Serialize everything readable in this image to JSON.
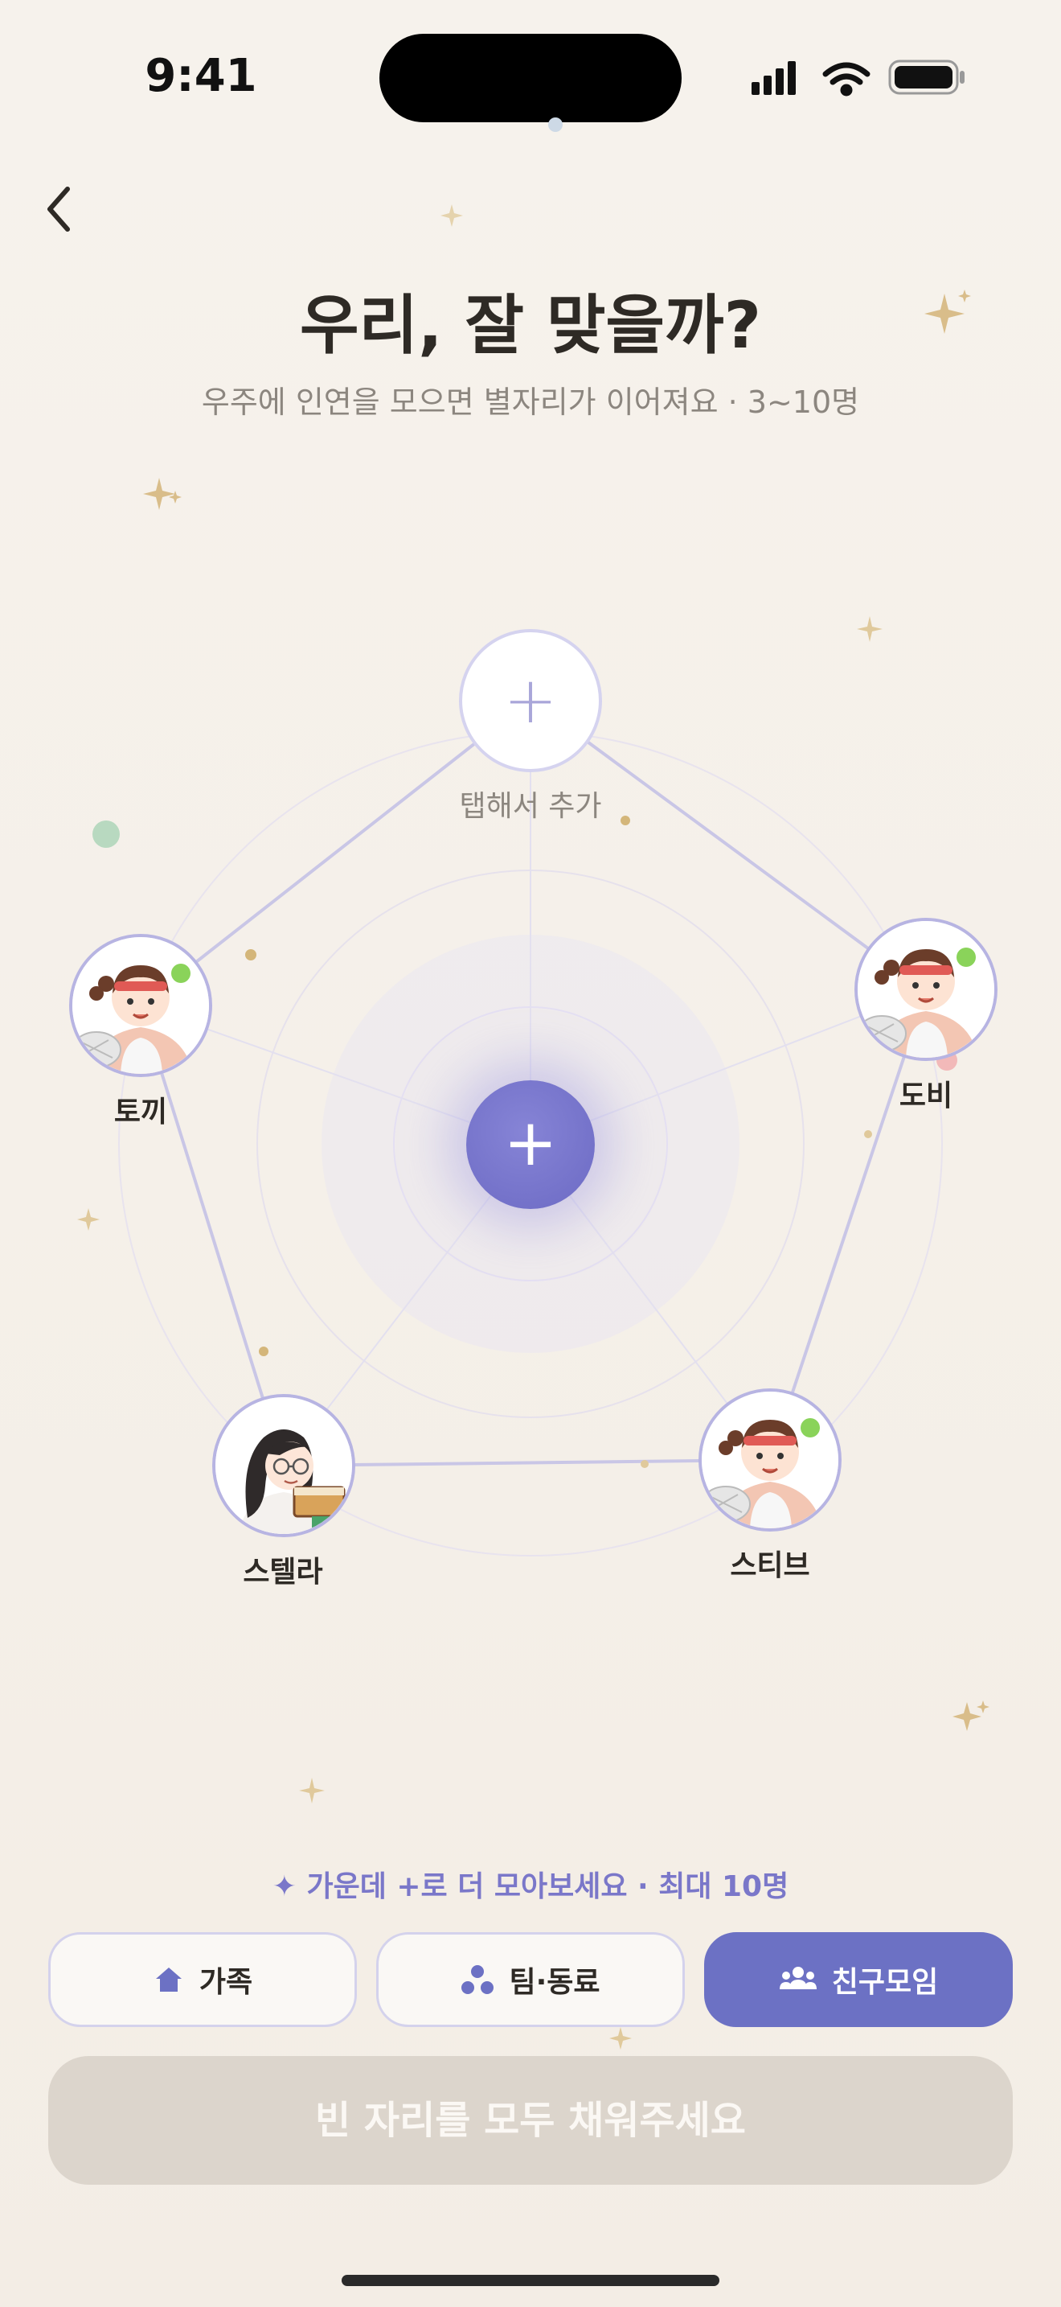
{
  "status_bar": {
    "time": "9:41"
  },
  "header": {
    "title": "우리, 잘 맞을까?",
    "subtitle": "우주에 인연을 모으면 별자리가 이어져요 · 3~10명"
  },
  "constellation": {
    "empty_slot_label": "탭해서 추가",
    "members": [
      {
        "name": "토끼",
        "avatar": "tennis-girl-avatar"
      },
      {
        "name": "도비",
        "avatar": "tennis-girl-avatar"
      },
      {
        "name": "스텔라",
        "avatar": "glasses-girl-avatar"
      },
      {
        "name": "스티브",
        "avatar": "tennis-girl-avatar"
      }
    ],
    "center_button": "+"
  },
  "hint": "✦ 가운데 +로 더 모아보세요 · 최대 10명",
  "categories": [
    {
      "label": "가족",
      "icon": "home-icon",
      "selected": false
    },
    {
      "label": "팀·동료",
      "icon": "team-icon",
      "selected": false
    },
    {
      "label": "친구모임",
      "icon": "group-icon",
      "selected": true
    }
  ],
  "submit_label": "빈 자리를 모두 채워주세요",
  "colors": {
    "accent": "#6c71c4",
    "disabled": "#dcd5cc",
    "background": "#f6f2ec"
  }
}
